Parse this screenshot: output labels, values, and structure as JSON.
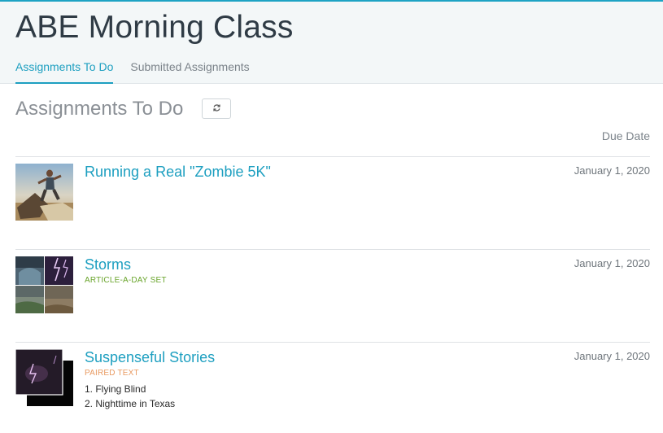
{
  "header": {
    "class_title": "ABE Morning Class",
    "tabs": [
      {
        "label": "Assignments To Do",
        "active": true
      },
      {
        "label": "Submitted Assignments",
        "active": false
      }
    ]
  },
  "main": {
    "section_title": "Assignments To Do",
    "refresh_icon": "refresh-icon",
    "due_header": "Due Date",
    "assignments": [
      {
        "title": "Running a Real \"Zombie 5K\"",
        "date": "January 1, 2020",
        "thumbnail": "runner-photo"
      },
      {
        "title": "Storms",
        "tag": "ARTICLE-A-DAY SET",
        "date": "January 1, 2020",
        "thumbnail": "storm-collage"
      },
      {
        "title": "Suspenseful Stories",
        "tag": "PAIRED TEXT",
        "date": "January 1, 2020",
        "thumbnail": "night-lightning",
        "items": [
          "1. Flying Blind",
          "2. Nighttime in Texas"
        ]
      }
    ]
  },
  "colors": {
    "accent": "#1d9fc0",
    "tag_green": "#6aa52c",
    "tag_orange": "#e89a62"
  }
}
